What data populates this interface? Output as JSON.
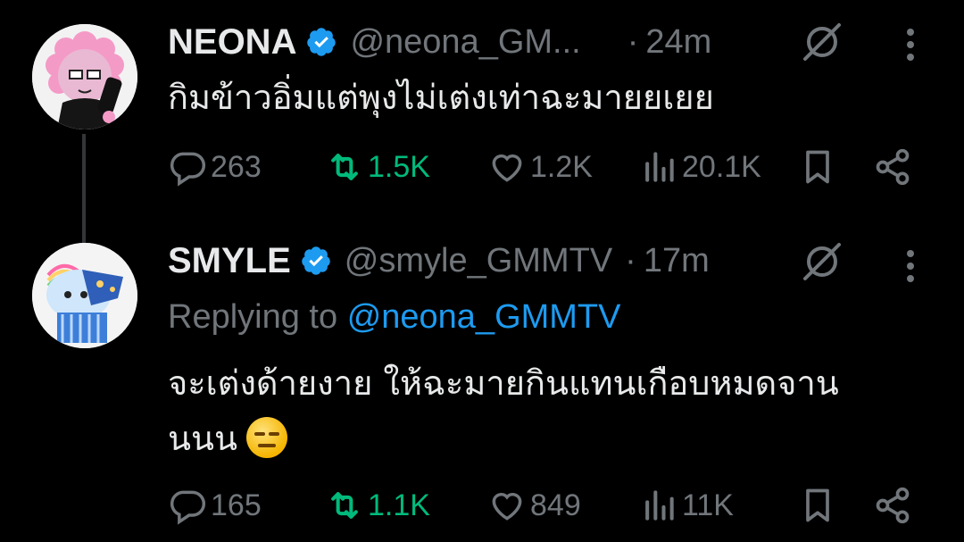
{
  "tweets": [
    {
      "name": "NEONA",
      "handle": "@neona_GM...",
      "dot": "·",
      "time": "24m",
      "text": "กิมข้าวอิ่มแต่พุงไม่เต่งเท่าฉะมายยเยย",
      "replies": "263",
      "reposts": "1.5K",
      "likes": "1.2K",
      "views": "20.1K"
    },
    {
      "name": "SMYLE",
      "handle": "@smyle_GMMTV",
      "dot": "·",
      "time": "17m",
      "replying_label": "Replying to",
      "replying_to": "@neona_GMMTV",
      "text_line1": "จะเต่งด้ายงาย ให้ฉะมายกินแทนเกือบหมดจาน",
      "text_line2": "นนน",
      "emoji": "expressionless-face-emoji",
      "replies": "165",
      "reposts": "1.1K",
      "likes": "849",
      "views": "11K"
    }
  ],
  "colors": {
    "background": "#000000",
    "text": "#e7e9ea",
    "muted": "#71767b",
    "link": "#1d9bf0",
    "repost_active": "#00ba7c",
    "verified": "#1d9bf0"
  },
  "icons": [
    "verified-badge-icon",
    "grok-icon",
    "more-icon",
    "reply-icon",
    "repost-icon",
    "like-icon",
    "views-icon",
    "bookmark-icon",
    "share-icon"
  ]
}
